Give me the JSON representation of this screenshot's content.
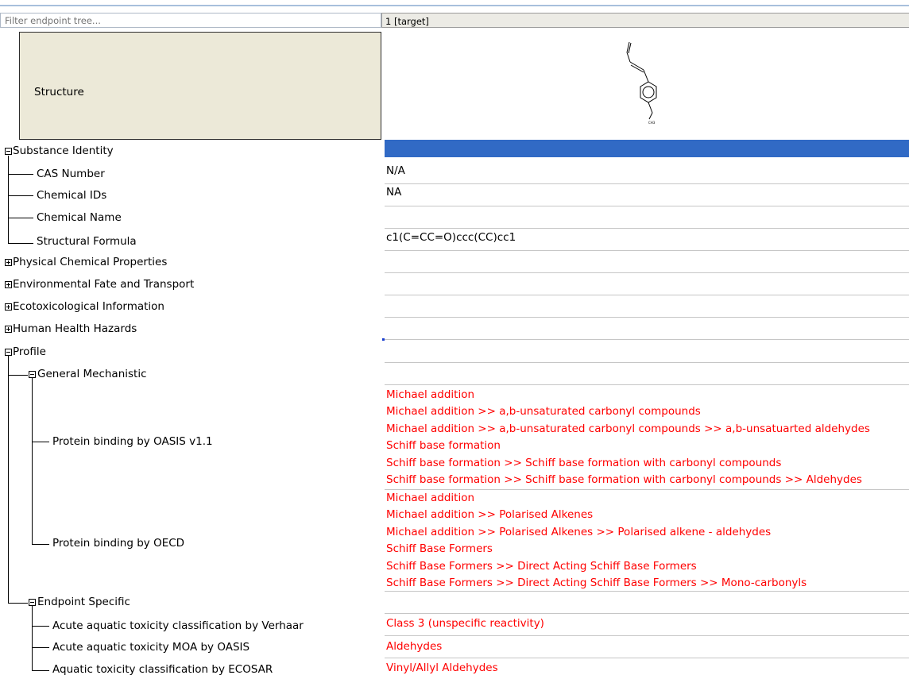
{
  "filter": {
    "placeholder": "Filter endpoint tree..."
  },
  "header": {
    "column_title": "1 [target]"
  },
  "structure": {
    "label": "Structure",
    "methyl_label": "CH3"
  },
  "tree": {
    "substance_identity": "Substance Identity",
    "cas_number": "CAS Number",
    "chemical_ids": "Chemical IDs",
    "chemical_name": "Chemical Name",
    "structural_formula": "Structural Formula",
    "physical_chemical": "Physical Chemical Properties",
    "env_fate": "Environmental Fate and Transport",
    "ecotox": "Ecotoxicological Information",
    "human_health": "Human Health Hazards",
    "profile": "Profile",
    "general_mechanistic": "General Mechanistic",
    "protein_oasis": "Protein binding by OASIS v1.1",
    "protein_oecd": "Protein binding by OECD",
    "endpoint_specific": "Endpoint Specific",
    "verhaar": "Acute aquatic toxicity classification by Verhaar",
    "moa_oasis": "Acute aquatic toxicity MOA by OASIS",
    "ecosar": "Aquatic toxicity classification by ECOSAR"
  },
  "values": {
    "cas_number": "N/A",
    "chemical_ids": "NA",
    "structural_formula": "c1(C=CC=O)ccc(CC)cc1",
    "protein_oasis": [
      "Michael addition",
      "Michael addition >> a,b-unsaturated carbonyl compounds",
      "Michael addition >> a,b-unsaturated carbonyl compounds >> a,b-unsatuarted aldehydes",
      "Schiff base formation",
      "Schiff base formation >> Schiff base formation with carbonyl compounds",
      "Schiff base formation >> Schiff base formation with carbonyl compounds >> Aldehydes"
    ],
    "protein_oecd": [
      "Michael addition",
      "Michael addition >> Polarised Alkenes",
      "Michael addition >> Polarised Alkenes >> Polarised alkene - aldehydes",
      "Schiff Base Formers",
      "Schiff Base Formers >> Direct Acting Schiff Base Formers",
      "Schiff Base Formers >> Direct Acting Schiff Base Formers >> Mono-carbonyls"
    ],
    "verhaar": "Class 3 (unspecific reactivity)",
    "moa_oasis": "Aldehydes",
    "ecosar": "Vinyl/Allyl Aldehydes"
  },
  "colors": {
    "selection": "#316ac5",
    "profile_text": "#ff0000"
  }
}
